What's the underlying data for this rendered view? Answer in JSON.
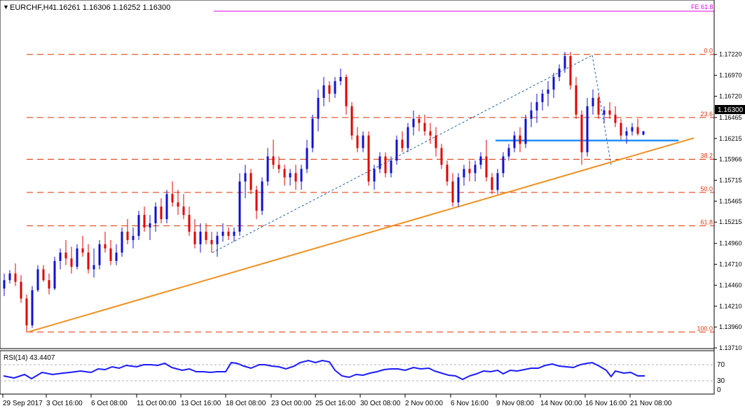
{
  "header": {
    "arrow": "▼",
    "symbol": "EURCHF,H4",
    "ohlc": "1.16261 1.16306 1.16252 1.16300"
  },
  "price_axis": {
    "ticks": [
      "1.17220",
      "1.16970",
      "1.16720",
      "1.16465",
      "1.16215",
      "1.15966",
      "1.15715",
      "1.15465",
      "1.15215",
      "1.14960",
      "1.14710",
      "1.14460",
      "1.14210",
      "1.13960",
      "1.13710"
    ],
    "current_price": "1.16300"
  },
  "time_axis": {
    "labels": [
      "29 Sep 2017",
      "3 Oct 16:00",
      "6 Oct 08:00",
      "11 Oct 00:00",
      "13 Oct 16:00",
      "18 Oct 08:00",
      "23 Oct 00:00",
      "25 Oct 16:00",
      "30 Oct 08:00",
      "2 Nov 00:00",
      "6 Nov 16:00",
      "9 Nov 08:00",
      "14 Nov 00:00",
      "16 Nov 16:00",
      "21 Nov 08:00"
    ]
  },
  "fibonacci": {
    "levels": [
      {
        "label": "0.0",
        "price": 1.1722
      },
      {
        "label": "23.6",
        "price": 1.16465
      },
      {
        "label": "38.2",
        "price": 1.15966
      },
      {
        "label": "50.0",
        "price": 1.1557
      },
      {
        "label": "61.8",
        "price": 1.1517
      },
      {
        "label": "100.0",
        "price": 1.139
      }
    ],
    "fe_label": "FE 61.8",
    "fe_price": 1.1753
  },
  "rsi": {
    "label": "RSI(14) 43.4407",
    "ticks": [
      "70",
      "30",
      "0"
    ]
  },
  "colors": {
    "bull": "#1010d0",
    "bear": "#e00000",
    "fib": "#e03000",
    "fe": "#e000e0",
    "trendline": "#f09020",
    "support": "#1e90ff",
    "rsi": "#1a1aff",
    "grid": "#c0c0c0"
  },
  "chart_data": {
    "type": "candlestick",
    "symbol": "EURCHF",
    "timeframe": "H4",
    "ylim": [
      1.1371,
      1.1772
    ],
    "series": [
      {
        "o": 1.1442,
        "h": 1.146,
        "l": 1.1433,
        "c": 1.1452
      },
      {
        "o": 1.1452,
        "h": 1.1464,
        "l": 1.1448,
        "c": 1.146
      },
      {
        "o": 1.146,
        "h": 1.1472,
        "l": 1.1445,
        "c": 1.145
      },
      {
        "o": 1.145,
        "h": 1.1458,
        "l": 1.1425,
        "c": 1.143
      },
      {
        "o": 1.143,
        "h": 1.1435,
        "l": 1.139,
        "c": 1.1398
      },
      {
        "o": 1.1398,
        "h": 1.1445,
        "l": 1.1395,
        "c": 1.144
      },
      {
        "o": 1.144,
        "h": 1.147,
        "l": 1.1438,
        "c": 1.1465
      },
      {
        "o": 1.1465,
        "h": 1.147,
        "l": 1.145,
        "c": 1.1452
      },
      {
        "o": 1.1452,
        "h": 1.146,
        "l": 1.1435,
        "c": 1.1442
      },
      {
        "o": 1.1442,
        "h": 1.148,
        "l": 1.144,
        "c": 1.1475
      },
      {
        "o": 1.1475,
        "h": 1.149,
        "l": 1.1465,
        "c": 1.1485
      },
      {
        "o": 1.1485,
        "h": 1.15,
        "l": 1.147,
        "c": 1.1478
      },
      {
        "o": 1.1478,
        "h": 1.1492,
        "l": 1.146,
        "c": 1.1468
      },
      {
        "o": 1.1468,
        "h": 1.1495,
        "l": 1.1465,
        "c": 1.149
      },
      {
        "o": 1.149,
        "h": 1.1505,
        "l": 1.148,
        "c": 1.1485
      },
      {
        "o": 1.1485,
        "h": 1.1495,
        "l": 1.146,
        "c": 1.1465
      },
      {
        "o": 1.1465,
        "h": 1.149,
        "l": 1.1455,
        "c": 1.147
      },
      {
        "o": 1.147,
        "h": 1.15,
        "l": 1.1465,
        "c": 1.1495
      },
      {
        "o": 1.1495,
        "h": 1.151,
        "l": 1.1485,
        "c": 1.149
      },
      {
        "o": 1.149,
        "h": 1.15,
        "l": 1.147,
        "c": 1.1475
      },
      {
        "o": 1.1475,
        "h": 1.1495,
        "l": 1.147,
        "c": 1.1485
      },
      {
        "o": 1.1485,
        "h": 1.1515,
        "l": 1.148,
        "c": 1.151
      },
      {
        "o": 1.151,
        "h": 1.1525,
        "l": 1.1495,
        "c": 1.15
      },
      {
        "o": 1.15,
        "h": 1.1515,
        "l": 1.149,
        "c": 1.1505
      },
      {
        "o": 1.1505,
        "h": 1.1535,
        "l": 1.15,
        "c": 1.153
      },
      {
        "o": 1.153,
        "h": 1.154,
        "l": 1.151,
        "c": 1.1515
      },
      {
        "o": 1.1515,
        "h": 1.153,
        "l": 1.15,
        "c": 1.152
      },
      {
        "o": 1.152,
        "h": 1.1545,
        "l": 1.151,
        "c": 1.154
      },
      {
        "o": 1.154,
        "h": 1.155,
        "l": 1.152,
        "c": 1.1525
      },
      {
        "o": 1.1525,
        "h": 1.156,
        "l": 1.152,
        "c": 1.1555
      },
      {
        "o": 1.1555,
        "h": 1.157,
        "l": 1.154,
        "c": 1.1545
      },
      {
        "o": 1.1545,
        "h": 1.156,
        "l": 1.153,
        "c": 1.154
      },
      {
        "o": 1.154,
        "h": 1.1555,
        "l": 1.1525,
        "c": 1.153
      },
      {
        "o": 1.153,
        "h": 1.154,
        "l": 1.1505,
        "c": 1.151
      },
      {
        "o": 1.151,
        "h": 1.1525,
        "l": 1.149,
        "c": 1.1495
      },
      {
        "o": 1.1495,
        "h": 1.152,
        "l": 1.1485,
        "c": 1.151
      },
      {
        "o": 1.151,
        "h": 1.152,
        "l": 1.1495,
        "c": 1.15
      },
      {
        "o": 1.15,
        "h": 1.151,
        "l": 1.1485,
        "c": 1.1495
      },
      {
        "o": 1.1495,
        "h": 1.151,
        "l": 1.148,
        "c": 1.1505
      },
      {
        "o": 1.1505,
        "h": 1.152,
        "l": 1.1498,
        "c": 1.151
      },
      {
        "o": 1.151,
        "h": 1.1515,
        "l": 1.15,
        "c": 1.1505
      },
      {
        "o": 1.1505,
        "h": 1.1515,
        "l": 1.1498,
        "c": 1.151
      },
      {
        "o": 1.151,
        "h": 1.158,
        "l": 1.1505,
        "c": 1.157
      },
      {
        "o": 1.157,
        "h": 1.159,
        "l": 1.155,
        "c": 1.158
      },
      {
        "o": 1.158,
        "h": 1.1585,
        "l": 1.1555,
        "c": 1.156
      },
      {
        "o": 1.156,
        "h": 1.1565,
        "l": 1.1525,
        "c": 1.1535
      },
      {
        "o": 1.1535,
        "h": 1.1575,
        "l": 1.153,
        "c": 1.157
      },
      {
        "o": 1.157,
        "h": 1.161,
        "l": 1.1565,
        "c": 1.16
      },
      {
        "o": 1.16,
        "h": 1.162,
        "l": 1.1585,
        "c": 1.159
      },
      {
        "o": 1.159,
        "h": 1.16,
        "l": 1.158,
        "c": 1.1585
      },
      {
        "o": 1.1585,
        "h": 1.159,
        "l": 1.1565,
        "c": 1.1575
      },
      {
        "o": 1.1575,
        "h": 1.1585,
        "l": 1.1565,
        "c": 1.158
      },
      {
        "o": 1.158,
        "h": 1.159,
        "l": 1.156,
        "c": 1.157
      },
      {
        "o": 1.157,
        "h": 1.159,
        "l": 1.156,
        "c": 1.1585
      },
      {
        "o": 1.1585,
        "h": 1.162,
        "l": 1.158,
        "c": 1.161
      },
      {
        "o": 1.161,
        "h": 1.165,
        "l": 1.1605,
        "c": 1.1645
      },
      {
        "o": 1.1645,
        "h": 1.168,
        "l": 1.163,
        "c": 1.167
      },
      {
        "o": 1.167,
        "h": 1.1695,
        "l": 1.166,
        "c": 1.1685
      },
      {
        "o": 1.1685,
        "h": 1.169,
        "l": 1.1665,
        "c": 1.1675
      },
      {
        "o": 1.1675,
        "h": 1.1695,
        "l": 1.167,
        "c": 1.169
      },
      {
        "o": 1.169,
        "h": 1.1705,
        "l": 1.1685,
        "c": 1.1695
      },
      {
        "o": 1.1695,
        "h": 1.1698,
        "l": 1.165,
        "c": 1.166
      },
      {
        "o": 1.166,
        "h": 1.1665,
        "l": 1.162,
        "c": 1.1625
      },
      {
        "o": 1.1625,
        "h": 1.1635,
        "l": 1.1605,
        "c": 1.161
      },
      {
        "o": 1.161,
        "h": 1.163,
        "l": 1.1605,
        "c": 1.1625
      },
      {
        "o": 1.1625,
        "h": 1.163,
        "l": 1.1565,
        "c": 1.157
      },
      {
        "o": 1.157,
        "h": 1.159,
        "l": 1.156,
        "c": 1.1585
      },
      {
        "o": 1.1585,
        "h": 1.1605,
        "l": 1.158,
        "c": 1.16
      },
      {
        "o": 1.16,
        "h": 1.1605,
        "l": 1.1575,
        "c": 1.158
      },
      {
        "o": 1.158,
        "h": 1.16,
        "l": 1.1575,
        "c": 1.1595
      },
      {
        "o": 1.1595,
        "h": 1.1625,
        "l": 1.159,
        "c": 1.162
      },
      {
        "o": 1.162,
        "h": 1.163,
        "l": 1.1605,
        "c": 1.161
      },
      {
        "o": 1.161,
        "h": 1.164,
        "l": 1.1605,
        "c": 1.1635
      },
      {
        "o": 1.1635,
        "h": 1.1655,
        "l": 1.1625,
        "c": 1.1645
      },
      {
        "o": 1.1645,
        "h": 1.165,
        "l": 1.163,
        "c": 1.164
      },
      {
        "o": 1.164,
        "h": 1.165,
        "l": 1.1625,
        "c": 1.163
      },
      {
        "o": 1.163,
        "h": 1.164,
        "l": 1.1615,
        "c": 1.1625
      },
      {
        "o": 1.1625,
        "h": 1.1635,
        "l": 1.16,
        "c": 1.161
      },
      {
        "o": 1.161,
        "h": 1.1615,
        "l": 1.1585,
        "c": 1.159
      },
      {
        "o": 1.159,
        "h": 1.1595,
        "l": 1.1565,
        "c": 1.157
      },
      {
        "o": 1.157,
        "h": 1.158,
        "l": 1.154,
        "c": 1.1545
      },
      {
        "o": 1.1545,
        "h": 1.158,
        "l": 1.154,
        "c": 1.1575
      },
      {
        "o": 1.1575,
        "h": 1.159,
        "l": 1.1565,
        "c": 1.1585
      },
      {
        "o": 1.1585,
        "h": 1.1595,
        "l": 1.157,
        "c": 1.158
      },
      {
        "o": 1.158,
        "h": 1.1595,
        "l": 1.157,
        "c": 1.159
      },
      {
        "o": 1.159,
        "h": 1.1605,
        "l": 1.1585,
        "c": 1.16
      },
      {
        "o": 1.16,
        "h": 1.162,
        "l": 1.157,
        "c": 1.1575
      },
      {
        "o": 1.1575,
        "h": 1.158,
        "l": 1.1555,
        "c": 1.156
      },
      {
        "o": 1.156,
        "h": 1.1585,
        "l": 1.1555,
        "c": 1.158
      },
      {
        "o": 1.158,
        "h": 1.1605,
        "l": 1.1575,
        "c": 1.16
      },
      {
        "o": 1.16,
        "h": 1.1615,
        "l": 1.1595,
        "c": 1.161
      },
      {
        "o": 1.161,
        "h": 1.163,
        "l": 1.1605,
        "c": 1.1625
      },
      {
        "o": 1.1625,
        "h": 1.1635,
        "l": 1.1605,
        "c": 1.1615
      },
      {
        "o": 1.1615,
        "h": 1.165,
        "l": 1.161,
        "c": 1.1645
      },
      {
        "o": 1.1645,
        "h": 1.1665,
        "l": 1.1635,
        "c": 1.1655
      },
      {
        "o": 1.1655,
        "h": 1.1675,
        "l": 1.164,
        "c": 1.1665
      },
      {
        "o": 1.1665,
        "h": 1.168,
        "l": 1.1655,
        "c": 1.1675
      },
      {
        "o": 1.1675,
        "h": 1.169,
        "l": 1.166,
        "c": 1.168
      },
      {
        "o": 1.168,
        "h": 1.17,
        "l": 1.167,
        "c": 1.1695
      },
      {
        "o": 1.1695,
        "h": 1.171,
        "l": 1.169,
        "c": 1.1705
      },
      {
        "o": 1.1705,
        "h": 1.1725,
        "l": 1.17,
        "c": 1.172
      },
      {
        "o": 1.172,
        "h": 1.1725,
        "l": 1.168,
        "c": 1.1685
      },
      {
        "o": 1.1685,
        "h": 1.1695,
        "l": 1.1645,
        "c": 1.165
      },
      {
        "o": 1.165,
        "h": 1.1655,
        "l": 1.159,
        "c": 1.1605
      },
      {
        "o": 1.1605,
        "h": 1.167,
        "l": 1.16,
        "c": 1.166
      },
      {
        "o": 1.166,
        "h": 1.168,
        "l": 1.165,
        "c": 1.167
      },
      {
        "o": 1.167,
        "h": 1.1675,
        "l": 1.1645,
        "c": 1.165
      },
      {
        "o": 1.165,
        "h": 1.166,
        "l": 1.164,
        "c": 1.1655
      },
      {
        "o": 1.1655,
        "h": 1.1665,
        "l": 1.1645,
        "c": 1.165
      },
      {
        "o": 1.165,
        "h": 1.166,
        "l": 1.1635,
        "c": 1.164
      },
      {
        "o": 1.164,
        "h": 1.1645,
        "l": 1.162,
        "c": 1.1625
      },
      {
        "o": 1.1625,
        "h": 1.1635,
        "l": 1.1615,
        "c": 1.163
      },
      {
        "o": 1.163,
        "h": 1.164,
        "l": 1.1625,
        "c": 1.1635
      },
      {
        "o": 1.1635,
        "h": 1.1645,
        "l": 1.1625,
        "c": 1.1627
      },
      {
        "o": 1.16261,
        "h": 1.16306,
        "l": 1.16252,
        "c": 1.163
      }
    ]
  }
}
